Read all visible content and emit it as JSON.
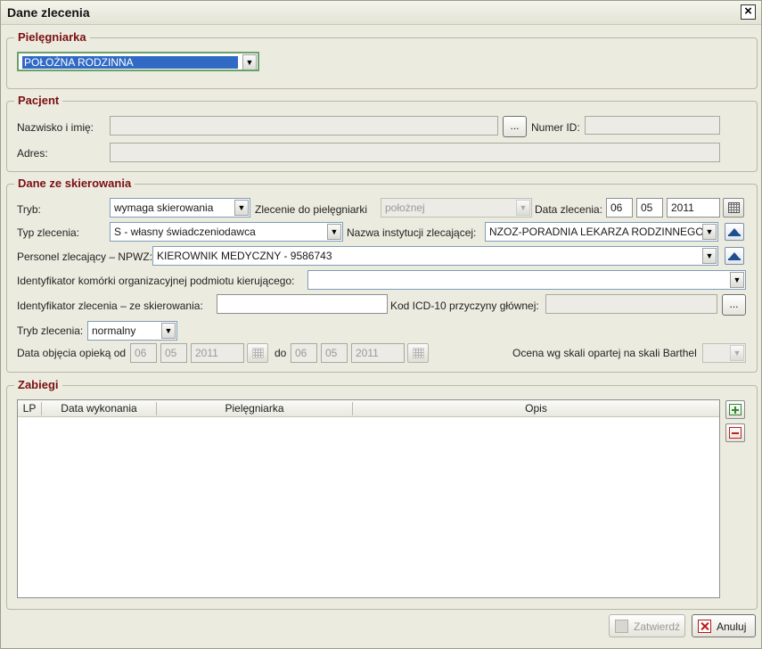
{
  "window": {
    "title": "Dane zlecenia"
  },
  "nurse_group": {
    "legend": "Pielęgniarka",
    "select_value": "POŁOŻNA RODZINNA"
  },
  "patient_group": {
    "legend": "Pacjent",
    "name_label": "Nazwisko i imię:",
    "name_value": "",
    "browse_label": "...",
    "id_label": "Numer ID:",
    "id_value": "",
    "address_label": "Adres:",
    "address_value": ""
  },
  "referral_group": {
    "legend": "Dane ze skierowania",
    "mode_label": "Tryb:",
    "mode_value": "wymaga skierowania",
    "order_to_label": "Zlecenie do pielęgniarki",
    "order_to_value": "położnej",
    "order_date_label": "Data zlecenia:",
    "order_date_day": "06",
    "order_date_month": "05",
    "order_date_year": "2011",
    "order_type_label": "Typ zlecenia:",
    "order_type_value": "S - własny świadczeniodawca",
    "institution_label": "Nazwa instytucji zlecającej:",
    "institution_value": "NZOZ-PORADNIA LEKARZA RODZINNEGO",
    "staff_label": "Personel zlecający – NPWZ:",
    "staff_value": "KIEROWNIK MEDYCZNY - 9586743",
    "unit_id_label": "Identyfikator komórki organizacyjnej podmiotu kierującego:",
    "unit_id_value": "",
    "referral_id_label": "Identyfikator zlecenia – ze skierowania:",
    "referral_id_value": "",
    "icd_label": "Kod ICD-10 przyczyny głównej:",
    "icd_value": "",
    "icd_browse_label": "...",
    "order_mode_label": "Tryb zlecenia:",
    "order_mode_value": "normalny",
    "care_from_label": "Data objęcia opieką od",
    "care_from_day": "06",
    "care_from_month": "05",
    "care_from_year": "2011",
    "care_to_label": "do",
    "care_to_day": "06",
    "care_to_month": "05",
    "care_to_year": "2011",
    "barthel_label": "Ocena wg skali opartej na skali Barthel",
    "barthel_value": ""
  },
  "procedures_group": {
    "legend": "Zabiegi",
    "columns": [
      "LP",
      "Data wykonania",
      "Pielęgniarka",
      "Opis"
    ],
    "rows": []
  },
  "footer": {
    "confirm_label": "Zatwierdź",
    "cancel_label": "Anuluj"
  },
  "icons": {
    "close": "close-icon",
    "calendar": "calendar-icon",
    "arrow_up": "arrow-up-icon",
    "add": "plus-icon",
    "remove": "minus-icon",
    "confirm": "confirm-icon",
    "cancel": "cancel-x-icon"
  }
}
